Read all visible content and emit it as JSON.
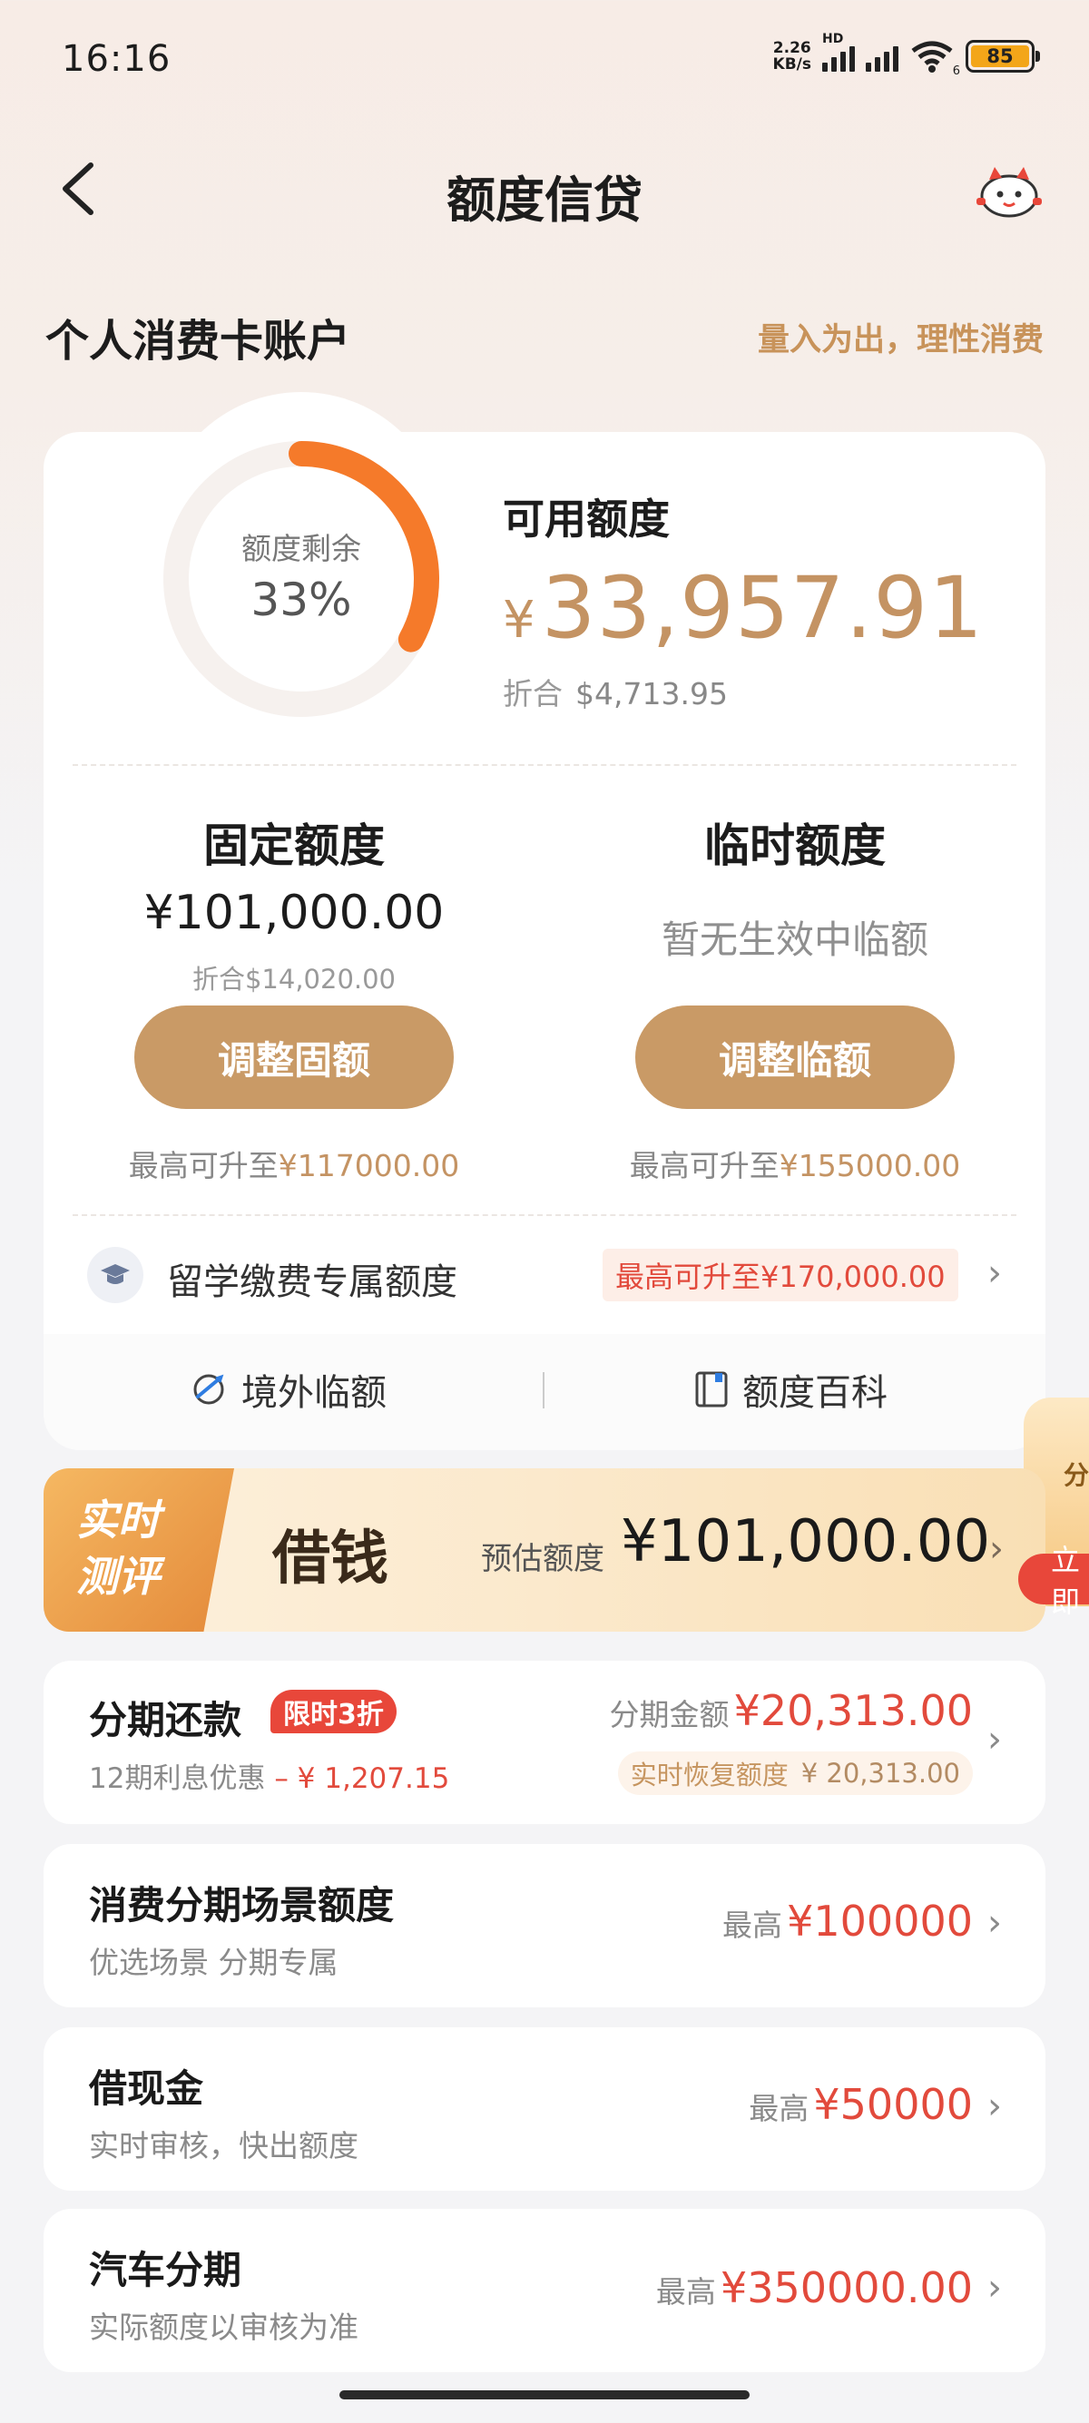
{
  "status_bar": {
    "time": "16:16",
    "net_speed_value": "2.26",
    "net_speed_unit": "KB/s",
    "hd_label": "HD",
    "wifi_sub": "6",
    "battery": "85"
  },
  "header": {
    "title": "额度信贷"
  },
  "account": {
    "section_title": "个人消费卡账户",
    "slogan": "量入为出，理性消费"
  },
  "available": {
    "ring_label": "额度剩余",
    "ring_percent_text": "33%",
    "ring_fraction": 0.33,
    "label": "可用额度",
    "currency": "¥",
    "amount": "33,957.91",
    "convert_label": "折合",
    "convert_value": "$4,713.95"
  },
  "fixed": {
    "title": "固定额度",
    "amount": "¥101,000.00",
    "convert": "折合$14,020.00",
    "button": "调整固额",
    "maxup_prefix": "最高可升至",
    "maxup_value": "¥117000.00"
  },
  "temporary": {
    "title": "临时额度",
    "none_text": "暂无生效中临额",
    "button": "调整临额",
    "maxup_prefix": "最高可升至",
    "maxup_value": "¥155000.00"
  },
  "study": {
    "label": "留学缴费专属额度",
    "badge": "最高可升至¥170,000.00"
  },
  "links": {
    "overseas": "境外临额",
    "wiki": "额度百科"
  },
  "banner": {
    "tag_line1": "实时",
    "tag_line2": "测评",
    "title": "借钱",
    "est_label": "预估额度",
    "amount": "¥101,000.00",
    "side_text": "分",
    "side_button": "立即"
  },
  "installment": {
    "title": "分期还款",
    "tag": "限时3折",
    "sub_prefix": "12期利息优惠",
    "sub_value": "– ¥ 1,207.15",
    "amount_label": "分期金额",
    "amount": "¥20,313.00",
    "restore_label": "实时恢复额度",
    "restore_value": "¥ 20,313.00"
  },
  "consumer": {
    "title": "消费分期场景额度",
    "sub": "优选场景 分期专属",
    "label": "最高",
    "amount": "¥100000"
  },
  "cash": {
    "title": "借现金",
    "sub": "实时审核，快出额度",
    "label": "最高",
    "amount": "¥50000"
  },
  "car": {
    "title": "汽车分期",
    "sub": "实际额度以审核为准",
    "label": "最高",
    "amount": "¥350000.00"
  },
  "colors": {
    "accent_gold": "#c99a66",
    "ring_orange": "#f57a2a",
    "red": "#e24a3c"
  }
}
